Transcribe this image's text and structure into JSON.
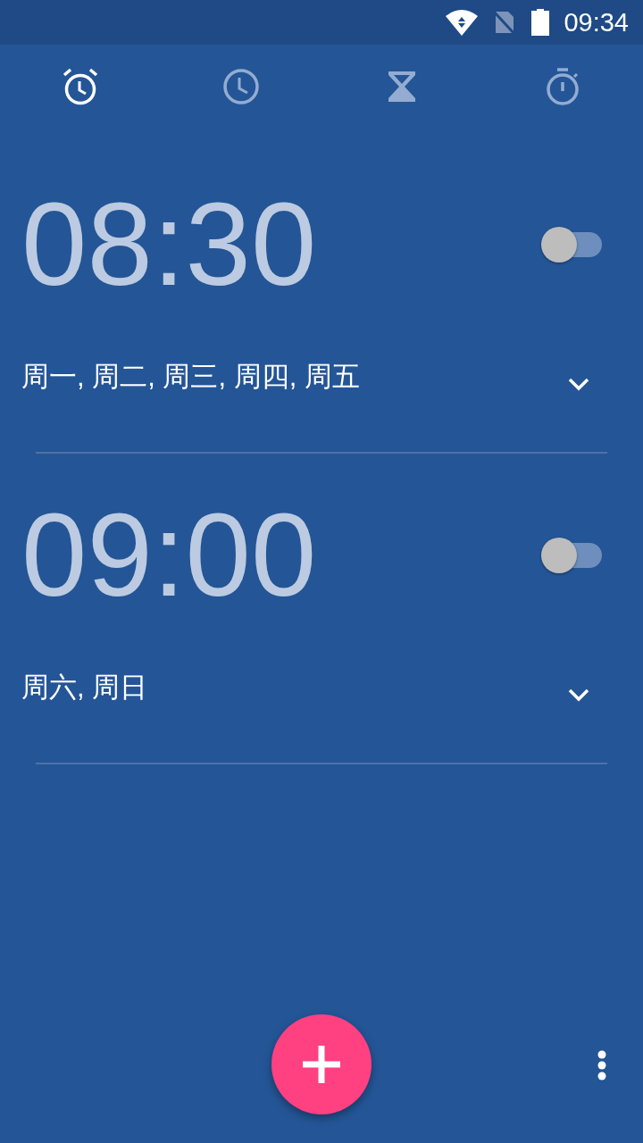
{
  "status_bar": {
    "time": "09:34"
  },
  "tabs": [
    {
      "kind": "alarm",
      "selected": true
    },
    {
      "kind": "clock",
      "selected": false
    },
    {
      "kind": "timer",
      "selected": false
    },
    {
      "kind": "stopwatch",
      "selected": false
    }
  ],
  "alarms": [
    {
      "time": "08:30",
      "on": false,
      "days": "周一, 周二, 周三, 周四, 周五",
      "expanded": false
    },
    {
      "time": "09:00",
      "on": false,
      "days": "周六, 周日",
      "expanded": false
    }
  ]
}
